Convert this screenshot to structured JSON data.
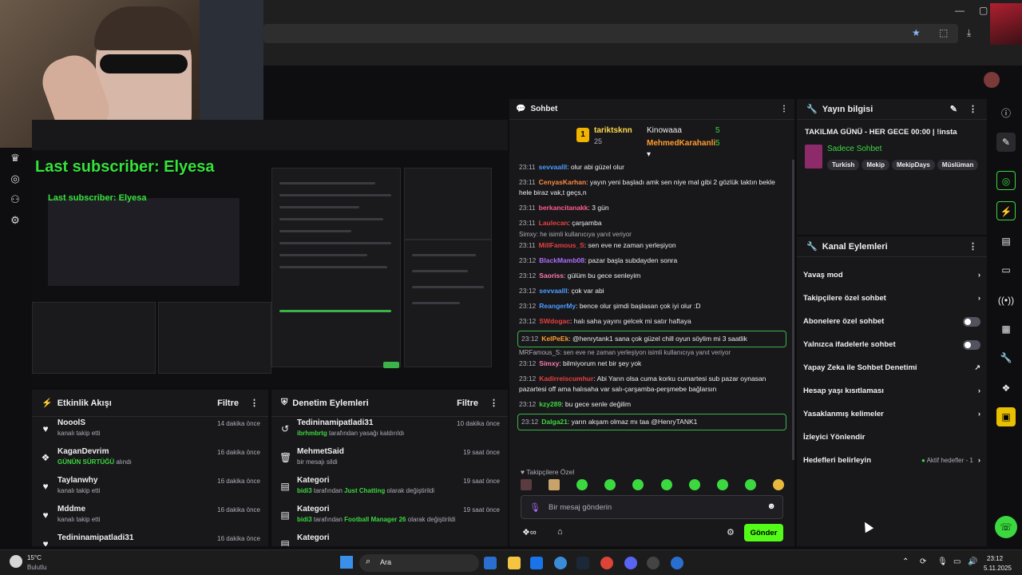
{
  "overlay": {
    "last_subscriber": "Last subscriber: Elyesa",
    "last_subscriber_small": "Last subscriber: Elyesa"
  },
  "activity": {
    "title": "Etkinlik Akışı",
    "filter": "Filtre",
    "items": [
      {
        "name": "NooolS",
        "sub": "kanalı takip etti",
        "time": "14 dakika önce",
        "icon": "heart-icon"
      },
      {
        "name": "KaganDevrim",
        "sub_green": "GÜNÜN SÜRTÜĞÜ",
        "sub": " alındı",
        "time": "16 dakika önce",
        "icon": "points-icon"
      },
      {
        "name": "Taylanwhy",
        "sub": "kanalı takip etti",
        "time": "16 dakika önce",
        "icon": "heart-icon"
      },
      {
        "name": "Mddme",
        "sub": "kanalı takip etti",
        "time": "16 dakika önce",
        "icon": "heart-icon"
      },
      {
        "name": "Tedininamipatladi31",
        "sub": "",
        "time": "16 dakika önce",
        "icon": "heart-icon"
      }
    ]
  },
  "moderation": {
    "title": "Denetim Eylemleri",
    "filter": "Filtre",
    "items": [
      {
        "name": "Tedininamipatladi31",
        "green": "ibrhmbrtg",
        "sub": " tarafından yasağı kaldırıldı",
        "time": "10 dakika önce",
        "icon": "undo-icon"
      },
      {
        "name": "MehmetSaid",
        "green": "",
        "sub": "bir mesajı sildi",
        "time": "19 saat önce",
        "icon": "trash-icon"
      },
      {
        "name": "Kategori",
        "green": "bidi3",
        "sub": " tarafından ",
        "green2": "Just Chatting",
        "sub2": " olarak değiştirildi",
        "time": "19 saat önce",
        "icon": "category-icon"
      },
      {
        "name": "Kategori",
        "green": "bidi3",
        "sub": " tarafından ",
        "green2": "Football Manager 26",
        "sub2": " olarak değiştirildi",
        "time": "19 saat önce",
        "icon": "category-icon"
      },
      {
        "name": "Kategori",
        "green": "",
        "sub": "",
        "time": "",
        "icon": "category-icon"
      }
    ]
  },
  "chat": {
    "title": "Sohbet",
    "leaderboard": {
      "first_name": "tariktsknn",
      "first_score": "25",
      "second_name": "Kinowaaa",
      "second_score": "5",
      "third_name": "MehmedKarahanli",
      "third_score": "5"
    },
    "messages": [
      {
        "t": "23:11",
        "u": "sevvaalll",
        "c": "#4d9cff",
        "m": ": olur abi güzel olur"
      },
      {
        "t": "23:11",
        "u": "CenyasKarhan",
        "c": "#ff8a3d",
        "m": ": yayın yeni başladı amk sen niye mal gibi 2 gözlük taktın bekle hele biraz vak,t geçs,n"
      },
      {
        "t": "23:11",
        "u": "berkancitanakk",
        "c": "#ff5c8a",
        "m": ": 3 gün"
      },
      {
        "t": "23:11",
        "u": "Laulecan",
        "c": "#e84040",
        "m": ": çarşamba"
      }
    ],
    "reply1": "Simxy: he isimli kullanıcıya yanıt veriyor",
    "messages2": [
      {
        "t": "23:11",
        "u": "MillFamous_S",
        "c": "#e84040",
        "m": ": sen eve ne zaman yerleşiyon"
      },
      {
        "t": "23:12",
        "u": "BlackMamb08",
        "c": "#b06cff",
        "m": ": pazar başla subdayden sonra"
      },
      {
        "t": "23:12",
        "u": "Saoriss",
        "c": "#ff7ab0",
        "m": ": gülüm bu gece senleyim"
      },
      {
        "t": "23:12",
        "u": "sevvaalll",
        "c": "#4d9cff",
        "m": ": çok var abi"
      },
      {
        "t": "23:12",
        "u": "ReangerMy",
        "c": "#4d9cff",
        "m": ": bence olur şimdi başlasan çok iyi olur :D"
      },
      {
        "t": "23:12",
        "u": "SWdogac",
        "c": "#e84040",
        "m": ": halı saha yayını gelcek mi satır haftaya"
      }
    ],
    "highlight1": {
      "t": "23:12",
      "u": "KelPeEk",
      "c": "#ff9d2e",
      "m": ": @henrytank1 sana çok güzel chill oyun söylim mi 3 saatlik"
    },
    "reply2": "MRFamous_S: sen eve ne zaman yerleşiyon isimli kullanıcıya yanıt veriyor",
    "messages3": [
      {
        "t": "23:12",
        "u": "Simxy",
        "c": "#ff7ab0",
        "m": ": bilmiyorum net bir şey yok"
      },
      {
        "t": "23:12",
        "u": "Kadirreiscumhur",
        "c": "#e84040",
        "m": ": Abi Yarın olsa cuma korku cumartesi sub pazar oynasan pazartesi off ama halısaha var salı-çarşamba-perşmebe bağlarsın"
      },
      {
        "t": "23:12",
        "u": "kzy289",
        "c": "#3bd83f",
        "m": ": bu gece senle değilim"
      }
    ],
    "highlight2": {
      "t": "23:12",
      "u": "Dalga21",
      "c": "#3bd83f",
      "m": ": yarın akşam olmaz mı taa @HenryTANK1"
    },
    "followers_only": "Takipçilere Özel",
    "input_placeholder": "Bir mesaj gönderin",
    "send": "Gönder"
  },
  "stream_info": {
    "title": "Yayın bilgisi",
    "stream_title": "TAKILMA GÜNÜ - HER GECE 00:00 | !insta",
    "category": "Sadece Sohbet",
    "tags": [
      "Turkish",
      "Mekip",
      "MekipDays",
      "Müslüman"
    ]
  },
  "channel_actions": {
    "title": "Kanal Eylemleri",
    "items": [
      {
        "label": "Yavaş mod",
        "kind": "chevron"
      },
      {
        "label": "Takipçilere özel sohbet",
        "kind": "chevron"
      },
      {
        "label": "Abonelere özel sohbet",
        "kind": "toggle"
      },
      {
        "label": "Yalnızca ifadelerle sohbet",
        "kind": "toggle"
      },
      {
        "label": "Yapay Zeka ile Sohbet Denetimi",
        "kind": "external"
      },
      {
        "label": "Hesap yaşı kısıtlaması",
        "kind": "chevron"
      },
      {
        "label": "Yasaklanmış kelimeler",
        "kind": "chevron"
      },
      {
        "label": "İzleyici Yönlendir",
        "kind": "none"
      },
      {
        "label": "Hedefleri belirleyin",
        "kind": "goal"
      }
    ],
    "goal_status": "Aktif hedefler - 1"
  },
  "taskbar": {
    "weather_temp": "15°C",
    "weather_text": "Bulutlu",
    "search": "Ara",
    "time": "23:12",
    "date": "5.11.2025"
  }
}
